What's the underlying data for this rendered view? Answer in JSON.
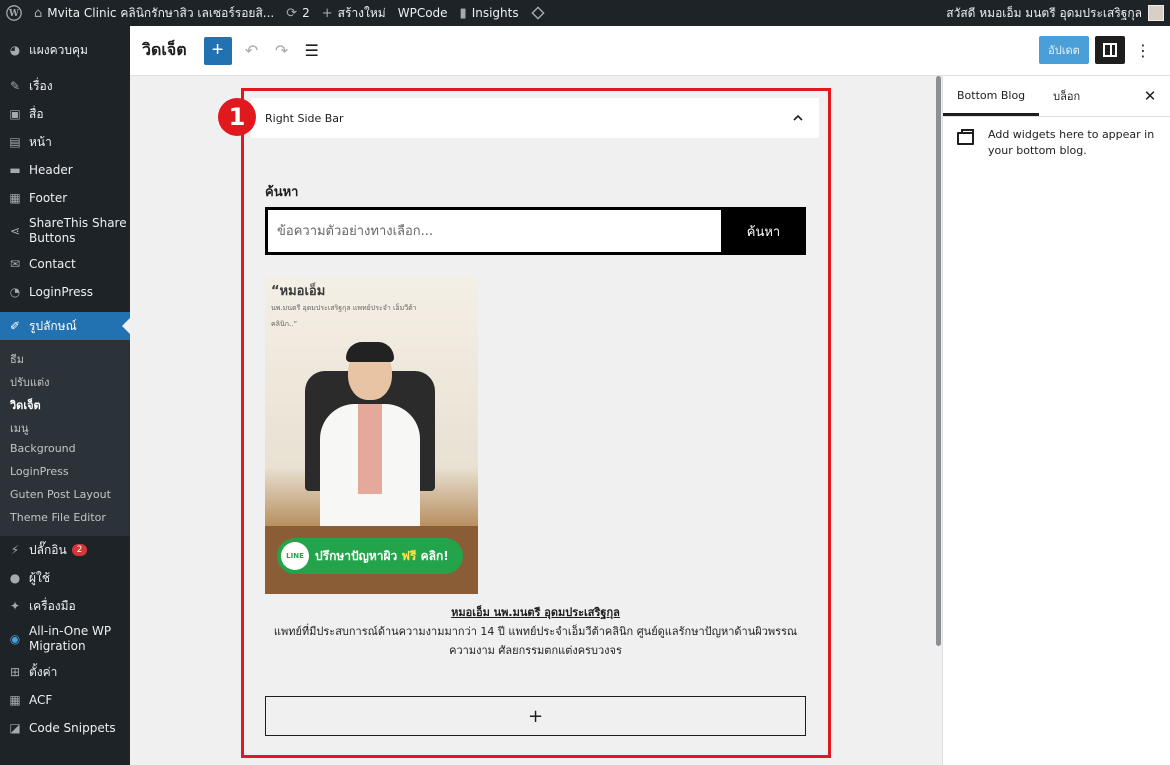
{
  "admin_bar": {
    "site_name": "Mvita Clinic คลินิกรักษาสิว เลเซอร์รอยสิ...",
    "updates_count": "2",
    "new_label": "สร้างใหม่",
    "wpcode_label": "WPCode",
    "insights_label": "Insights",
    "greeting": "สวัสดี หมอเอ็ม มนตรี อุดมประเสริฐกุล"
  },
  "sidebar": {
    "items": [
      {
        "label": "แผงควบคุม",
        "icon": "dashboard-icon"
      },
      {
        "label": "เรื่อง",
        "icon": "pin-icon"
      },
      {
        "label": "สื่อ",
        "icon": "media-icon"
      },
      {
        "label": "หน้า",
        "icon": "page-icon"
      },
      {
        "label": "Header",
        "icon": "folder-icon"
      },
      {
        "label": "Footer",
        "icon": "grid-icon"
      },
      {
        "label": "ShareThis Share Buttons",
        "icon": "share-icon"
      },
      {
        "label": "Contact",
        "icon": "mail-icon"
      },
      {
        "label": "LoginPress",
        "icon": "loginpress-icon"
      },
      {
        "label": "รูปลักษณ์",
        "icon": "brush-icon"
      }
    ],
    "submenu": [
      "ธีม",
      "ปรับแต่ง",
      "วิดเจ็ต",
      "เมนู",
      "Background",
      "LoginPress",
      "Guten Post Layout",
      "Theme File Editor"
    ],
    "after_items": [
      {
        "label": "ปลั๊กอิน",
        "icon": "plugin-icon",
        "badge": "2"
      },
      {
        "label": "ผู้ใช้",
        "icon": "user-icon"
      },
      {
        "label": "เครื่องมือ",
        "icon": "wrench-icon"
      },
      {
        "label": "All-in-One WP Migration",
        "icon": "migration-icon"
      },
      {
        "label": "ตั้งค่า",
        "icon": "settings-icon"
      },
      {
        "label": "ACF",
        "icon": "acf-icon"
      },
      {
        "label": "Code Snippets",
        "icon": "code-icon"
      }
    ]
  },
  "header": {
    "title": "วิดเจ็ต",
    "update_label": "อัปเดต"
  },
  "widget_area": {
    "step_number": "1",
    "title": "Right Side Bar",
    "search_label": "ค้นหา",
    "search_placeholder": "ข้อความตัวอย่างทางเลือก...",
    "search_button": "ค้นหา",
    "image_text": {
      "headline": "“หมอเอ็ม",
      "headline_sub": "นพ.มนตรี อุดมประเสริฐกุล แพทย์ประจำ เอ็มวีต้า คลินิก..”",
      "line_badge": "LINE",
      "cta_prefix": "ปรึกษาปัญหาผิว",
      "cta_free": "ฟรี",
      "cta_suffix": "คลิก!"
    },
    "caption_name": "หมอเอ็ม นพ.มนตรี อุดมประเสริฐกุล",
    "caption_desc": "แพทย์ที่มีประสบการณ์ด้านความงามมากว่า 14 ปี แพทย์ประจำเอ็มวีต้าคลินิก ศูนย์ดูแลรักษาปัญหาด้านผิวพรรณ ความงาม ศัลยกรรมตกแต่งครบวงจร",
    "add_block_label": "+"
  },
  "settings_panel": {
    "tabs": [
      "Bottom Blog",
      "บล็อก"
    ],
    "info_text": "Add widgets here to appear in your bottom blog."
  },
  "colors": {
    "accent": "#2271b1",
    "highlight": "#e0191e",
    "admin_dark": "#1d2327"
  }
}
